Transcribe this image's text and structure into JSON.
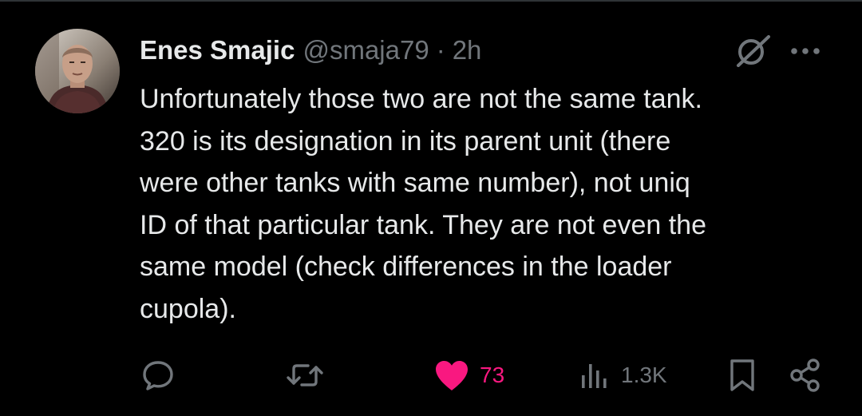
{
  "author": {
    "display_name": "Enes Smajic",
    "handle": "@smaja79",
    "separator": "·",
    "time": "2h"
  },
  "tweet": {
    "lines": [
      "Unfortunately those two are not the same tank.",
      "320 is its designation in its parent unit (there",
      "were other tanks with same number), not uniq",
      "ID of that particular tank. They are not even the",
      "same model (check differences in the loader",
      "cupola)."
    ]
  },
  "actions": {
    "reply": {
      "icon": "reply-icon"
    },
    "retweet": {
      "icon": "retweet-icon"
    },
    "like": {
      "icon": "heart-icon",
      "count": "73",
      "liked": true
    },
    "views": {
      "icon": "views-icon",
      "count": "1.3K"
    },
    "bookmark": {
      "icon": "bookmark-icon"
    },
    "share": {
      "icon": "share-icon"
    }
  },
  "colors": {
    "background": "#000000",
    "text": "#e7e9ea",
    "muted": "#71767b",
    "like": "#f91880"
  }
}
